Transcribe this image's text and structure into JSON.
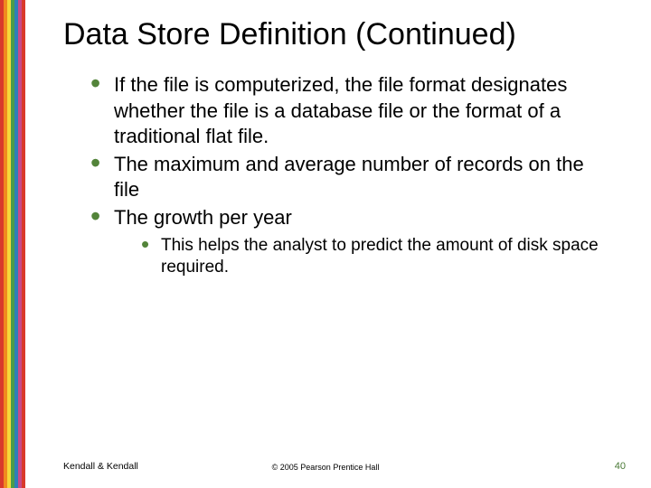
{
  "title": "Data Store Definition (Continued)",
  "bullets": {
    "b1": "If the file is computerized, the file format designates whether the file is a database file or the format of a traditional flat file.",
    "b2": "The maximum and average number of records on the file",
    "b3": "The growth per year",
    "sub1": "This helps the analyst to predict the amount of disk space required."
  },
  "footer": {
    "left": "Kendall & Kendall",
    "center": "© 2005 Pearson Prentice Hall",
    "right": "40"
  }
}
